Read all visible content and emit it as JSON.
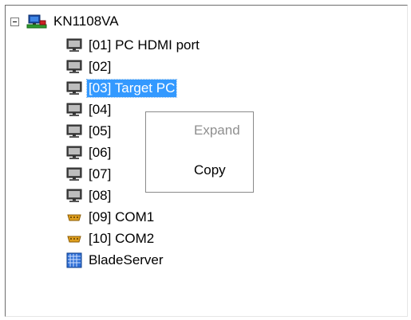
{
  "tree": {
    "root": {
      "label": "KN1108VA",
      "expanded": true,
      "icon": "kvm-switch-icon"
    },
    "items": [
      {
        "label": "[01] PC HDMI port",
        "icon": "monitor-icon",
        "selected": false
      },
      {
        "label": "[02]",
        "icon": "monitor-icon",
        "selected": false
      },
      {
        "label": "[03] Target PC",
        "icon": "monitor-icon",
        "selected": true
      },
      {
        "label": "[04]",
        "icon": "monitor-icon",
        "selected": false
      },
      {
        "label": "[05]",
        "icon": "monitor-icon",
        "selected": false
      },
      {
        "label": "[06]",
        "icon": "monitor-icon",
        "selected": false
      },
      {
        "label": "[07]",
        "icon": "monitor-icon",
        "selected": false
      },
      {
        "label": "[08]",
        "icon": "monitor-icon",
        "selected": false
      },
      {
        "label": "[09] COM1",
        "icon": "serial-port-icon",
        "selected": false
      },
      {
        "label": "[10] COM2",
        "icon": "serial-port-icon",
        "selected": false
      },
      {
        "label": "BladeServer",
        "icon": "blade-server-icon",
        "selected": false
      }
    ]
  },
  "context_menu": {
    "items": [
      {
        "label": "Expand",
        "enabled": false
      },
      {
        "label": "Copy",
        "enabled": true
      }
    ]
  },
  "colors": {
    "selection": "#3399ff",
    "disabled_text": "#8f8f8f"
  }
}
